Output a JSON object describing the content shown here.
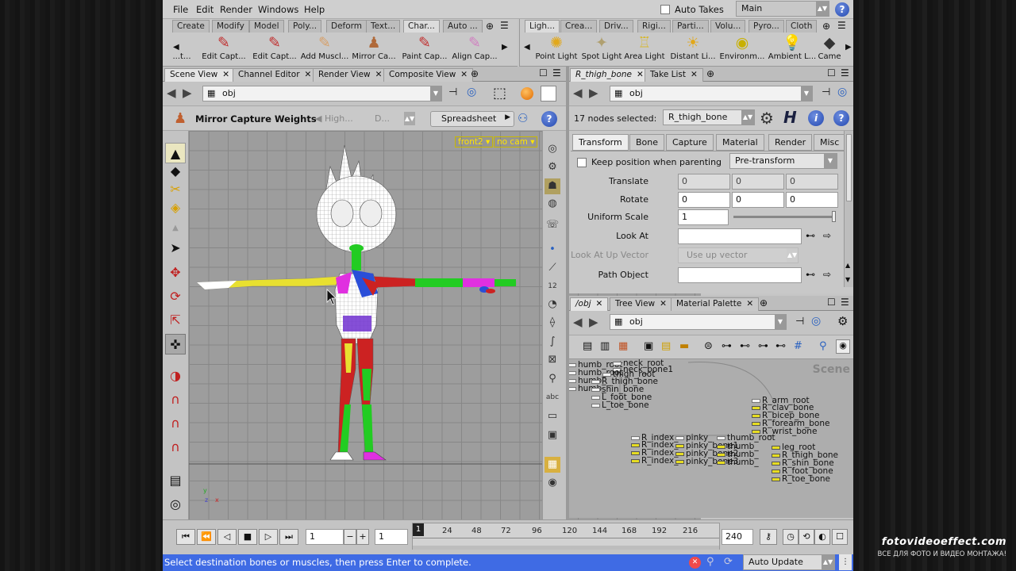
{
  "menubar": {
    "items": [
      "File",
      "Edit",
      "Render",
      "Windows",
      "Help"
    ],
    "auto_takes": "Auto Takes",
    "desktop": "Main"
  },
  "shelf_left": {
    "tabs": [
      "Create",
      "Modify",
      "Model",
      "Poly...",
      "Deform",
      "Text...",
      "Char...",
      "Auto ..."
    ],
    "tools": [
      {
        "label": "...t...",
        "icon": "scroll-left-tool-icon"
      },
      {
        "label": "Edit Capt...",
        "icon": "edit-capture-icon"
      },
      {
        "label": "Edit Capt...",
        "icon": "edit-capture-paint-icon"
      },
      {
        "label": "Add Muscl...",
        "icon": "add-muscle-icon"
      },
      {
        "label": "Mirror Ca...",
        "icon": "mirror-capture-icon"
      },
      {
        "label": "Paint Cap...",
        "icon": "paint-capture-icon"
      },
      {
        "label": "Align Cap...",
        "icon": "align-capture-icon"
      }
    ]
  },
  "shelf_right": {
    "tabs": [
      "Ligh...",
      "Crea...",
      "Driv...",
      "Rigi...",
      "Parti...",
      "Volu...",
      "Pyro...",
      "Cloth"
    ],
    "tools": [
      {
        "label": "Point Light",
        "icon": "point-light-icon"
      },
      {
        "label": "Spot Light",
        "icon": "spot-light-icon"
      },
      {
        "label": "Area Light",
        "icon": "area-light-icon"
      },
      {
        "label": "Distant Li...",
        "icon": "distant-light-icon"
      },
      {
        "label": "Environm...",
        "icon": "environment-light-icon"
      },
      {
        "label": "Ambient L...",
        "icon": "ambient-light-icon"
      },
      {
        "label": "Came",
        "icon": "camera-icon"
      }
    ]
  },
  "left_pane": {
    "tabs": [
      "Scene View",
      "Channel Editor",
      "Render View",
      "Composite View"
    ],
    "path": "obj",
    "tool_title": "Mirror Capture Weights",
    "tool_opt1": "High...",
    "tool_opt2": "D...",
    "spreadsheet": "Spreadsheet",
    "viewport_cam": "front2",
    "viewport_nocam": "no cam",
    "axis_y": "y",
    "axis_z": "z",
    "axis_x": "x"
  },
  "param_pane": {
    "tabs": [
      "R_thigh_bone",
      "Take List"
    ],
    "path": "obj",
    "selected_text": "17 nodes selected:",
    "selected_node": "R_thigh_bone",
    "h_label": "H",
    "param_tabs": [
      "Transform",
      "Bone",
      "Capture",
      "Material",
      "Render",
      "Misc"
    ],
    "keep_position": "Keep position when parenting",
    "pre_transform": "Pre-transform",
    "translate_label": "Translate",
    "translate": [
      "0",
      "0",
      "0"
    ],
    "rotate_label": "Rotate",
    "rotate": [
      "0",
      "0",
      "0"
    ],
    "uniform_scale_label": "Uniform Scale",
    "uniform_scale": "1",
    "uniform_scale_fill": 1.0,
    "look_at_label": "Look At",
    "look_at": "",
    "look_at_up_label": "Look At Up Vector",
    "look_at_up": "Use up vector",
    "path_object_label": "Path Object",
    "path_object": ""
  },
  "network_pane": {
    "tabs": [
      "/obj",
      "Tree View",
      "Material Palette"
    ],
    "path": "obj",
    "scene_label": "Scene",
    "nodes_white": [
      "humb_root",
      "neck_root",
      "neck_bone1",
      "humb_root",
      "thigh_root",
      "humb_",
      "R_thigh_bone",
      "humb_",
      "shin_bone",
      "L_foot_bone",
      "L_toe_bone",
      "R_arm_root",
      "R_index_",
      "pinky_",
      "thumb_root"
    ],
    "nodes_yellow": [
      "R_clav_bone",
      "R_bicep_bone",
      "R_forearm_bone",
      "R_wrist_bone",
      "R_index_",
      "R_index_",
      "R_index_",
      "pinky_bone1",
      "pinky_bone2",
      "pinky_bone3",
      "thumb_",
      "thumb_",
      "thumb_",
      "leg_root",
      "R_thigh_bone",
      "R_shin_bone",
      "R_foot_bone",
      "R_toe_bone"
    ]
  },
  "timeline": {
    "frame": "1",
    "step": "1",
    "ticks": [
      "1",
      "24",
      "48",
      "72",
      "96",
      "120",
      "144",
      "168",
      "192",
      "216"
    ],
    "end": "240",
    "playhead": 0
  },
  "status": {
    "message": "Select destination bones or muscles, then press Enter to complete.",
    "update_mode": "Auto Update"
  },
  "watermark": {
    "line1": "fotovideoeffect.com",
    "line2": "ВСЕ ДЛЯ ФОТО И ВИДЕО МОНТАЖА!"
  },
  "colors": {
    "status_bar": "#3f6be4",
    "viewport_bg": "#9d9d9d",
    "node_yellow": "#e6dc22",
    "vp_tag": "#ffe400"
  }
}
